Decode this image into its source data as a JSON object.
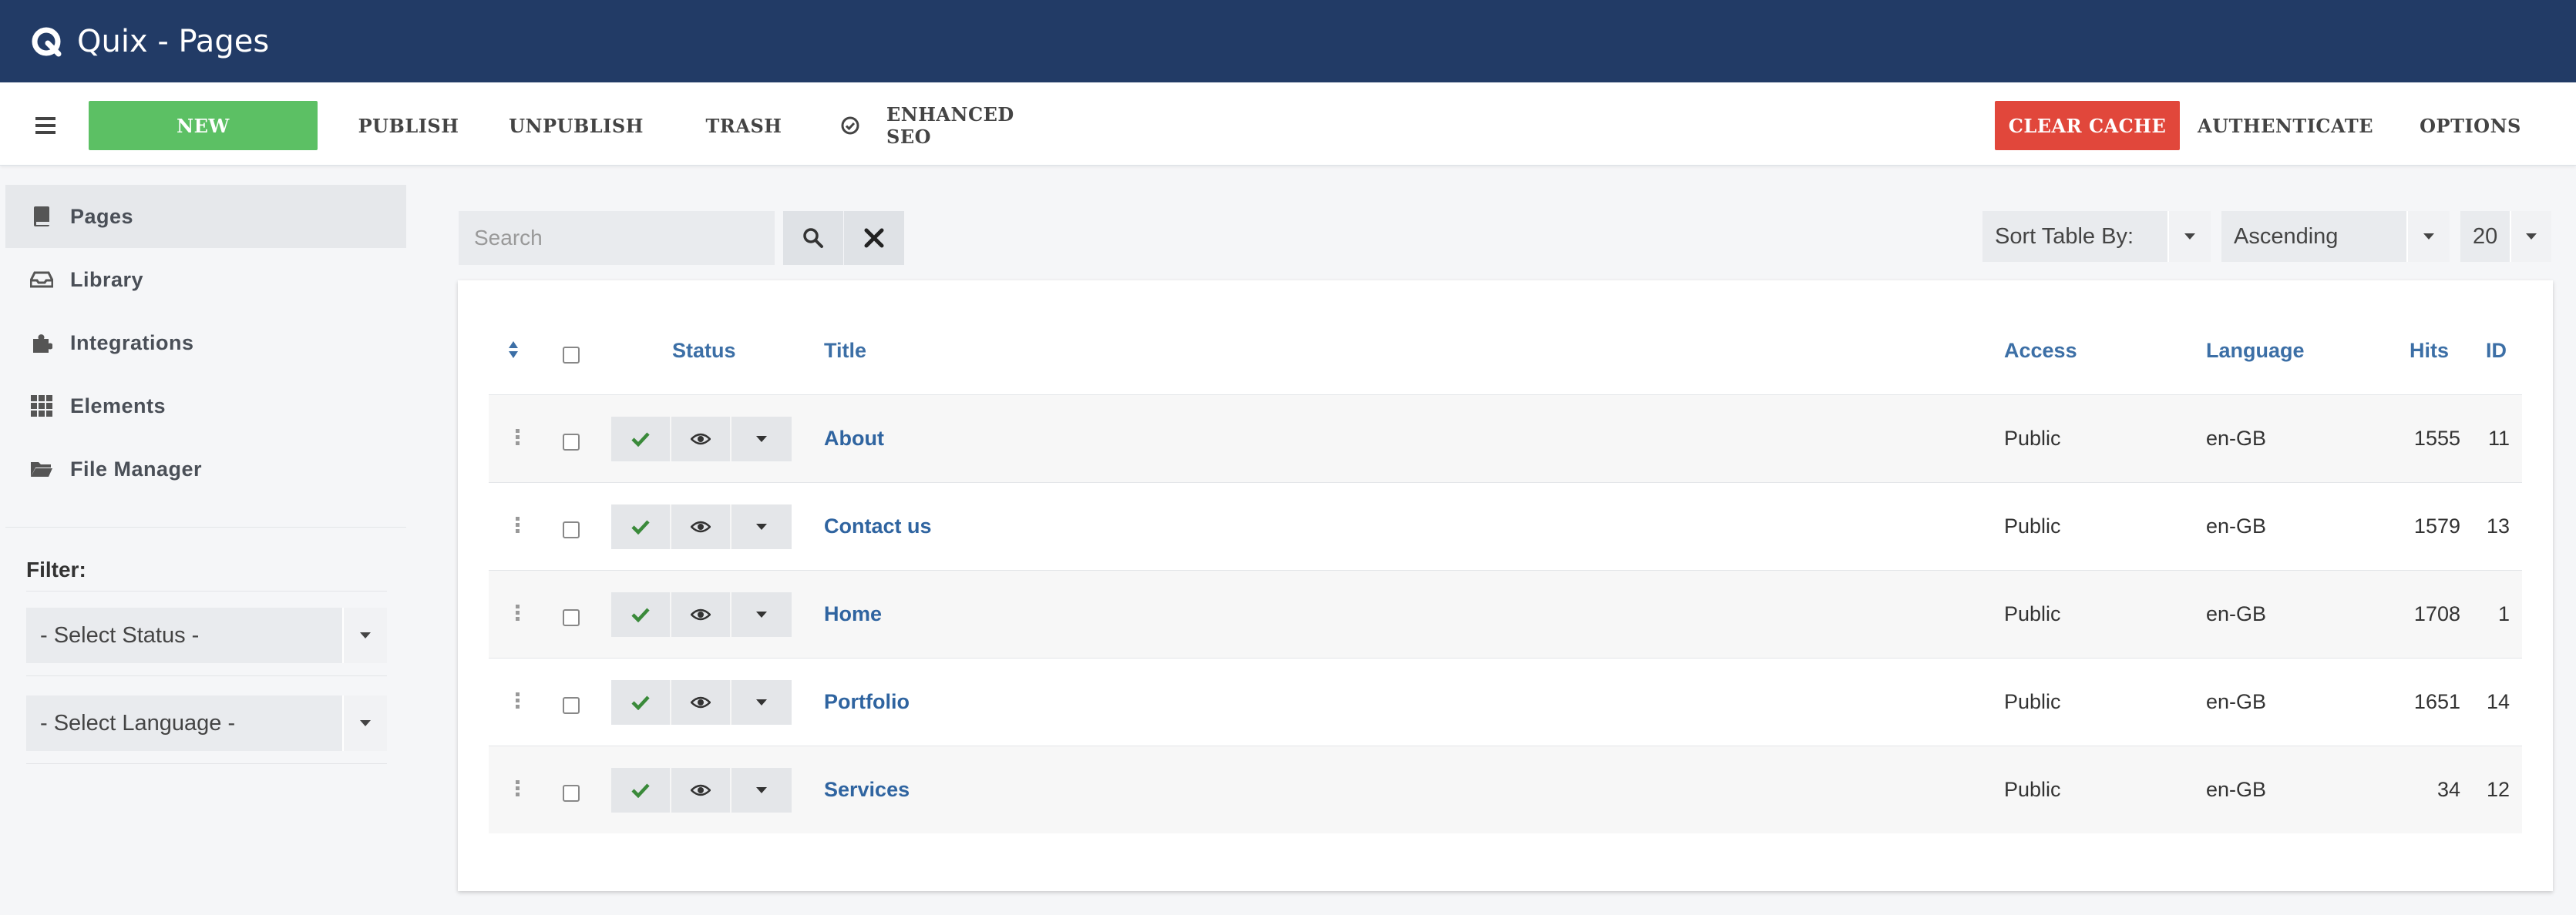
{
  "app": {
    "title": "Quix - Pages"
  },
  "toolbar": {
    "new_label": "NEW",
    "publish_label": "PUBLISH",
    "unpublish_label": "UNPUBLISH",
    "trash_label": "TRASH",
    "seo_label": "ENHANCED SEO",
    "clear_cache_label": "CLEAR CACHE",
    "authenticate_label": "AUTHENTICATE",
    "options_label": "OPTIONS"
  },
  "sidebar": {
    "items": [
      {
        "label": "Pages",
        "icon": "book-icon",
        "active": true
      },
      {
        "label": "Library",
        "icon": "inbox-icon",
        "active": false
      },
      {
        "label": "Integrations",
        "icon": "puzzle-icon",
        "active": false
      },
      {
        "label": "Elements",
        "icon": "grid-icon",
        "active": false
      },
      {
        "label": "File Manager",
        "icon": "folder-icon",
        "active": false
      }
    ],
    "filter_label": "Filter:",
    "status_select": "- Select Status -",
    "language_select": "- Select Language -"
  },
  "search": {
    "placeholder": "Search"
  },
  "sort": {
    "field": "Sort Table By:",
    "order": "Ascending",
    "limit": "20"
  },
  "table": {
    "headers": {
      "status": "Status",
      "title": "Title",
      "access": "Access",
      "language": "Language",
      "hits": "Hits",
      "id": "ID"
    },
    "rows": [
      {
        "title": "About",
        "access": "Public",
        "language": "en-GB",
        "hits": "1555",
        "id": "11"
      },
      {
        "title": "Contact us",
        "access": "Public",
        "language": "en-GB",
        "hits": "1579",
        "id": "13"
      },
      {
        "title": "Home",
        "access": "Public",
        "language": "en-GB",
        "hits": "1708",
        "id": "1"
      },
      {
        "title": "Portfolio",
        "access": "Public",
        "language": "en-GB",
        "hits": "1651",
        "id": "14"
      },
      {
        "title": "Services",
        "access": "Public",
        "language": "en-GB",
        "hits": "34",
        "id": "12"
      }
    ]
  },
  "colors": {
    "header": "#223b66",
    "new": "#5cc064",
    "clear_cache": "#e1473b",
    "link": "#2f64a0",
    "published": "#3a8a3a"
  }
}
